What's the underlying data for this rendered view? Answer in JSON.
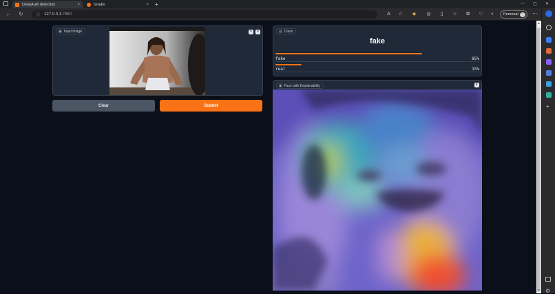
{
  "browser": {
    "tabs": [
      {
        "title": "DeepAuth detection",
        "active": true
      },
      {
        "title": "Gradio",
        "active": false
      }
    ],
    "new_tab": "+",
    "url_host": "127.0.0.1",
    "url_port": ":7860",
    "profile_label": "Personal"
  },
  "input_panel": {
    "label": "Input Image",
    "edit_icon": "pencil-icon",
    "close_icon": "close-icon"
  },
  "buttons": {
    "clear": "Clear",
    "submit": "Submit"
  },
  "class_panel": {
    "label": "Class",
    "prediction": "fake",
    "confidences": [
      {
        "label": "fake",
        "percent": "85%",
        "value": 0.85
      },
      {
        "label": "real",
        "percent": "15%",
        "value": 0.15
      }
    ]
  },
  "explain_panel": {
    "label": "Face with Explainability",
    "download_icon": "download-icon"
  },
  "colors": {
    "accent": "#f97316",
    "panel_bg": "#1f2937",
    "page_bg": "#0b0f19"
  }
}
